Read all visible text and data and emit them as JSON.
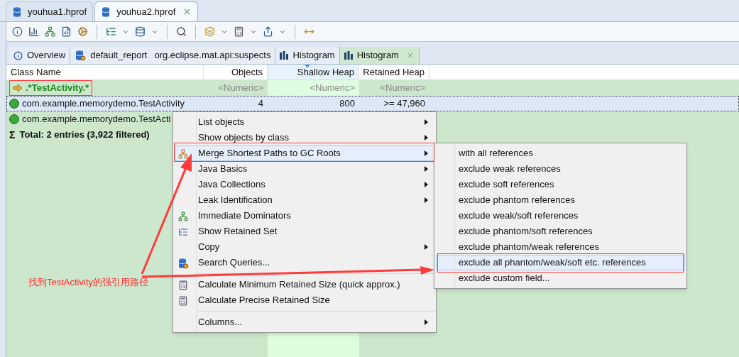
{
  "editor_tabs": [
    {
      "label": "youhua1.hprof",
      "selected": false,
      "closable": false
    },
    {
      "label": "youhua2.hprof",
      "selected": true,
      "closable": true
    }
  ],
  "result_tabs": [
    {
      "kind": "info",
      "label": "Overview",
      "selected": false
    },
    {
      "kind": "report",
      "label": "default_report",
      "detail": "org.eclipse.mat.api:suspects",
      "selected": false
    },
    {
      "kind": "histogram",
      "label": "Histogram",
      "selected": false,
      "closable": false
    },
    {
      "kind": "histogram",
      "label": "Histogram",
      "selected": true,
      "closable": true
    }
  ],
  "table": {
    "columns": [
      {
        "label": "Class Name",
        "sorted": false
      },
      {
        "label": "Objects",
        "sorted": false
      },
      {
        "label": "Shallow Heap",
        "sorted": true
      },
      {
        "label": "Retained Heap",
        "sorted": false
      }
    ],
    "filter_row": {
      "cells": [
        ".*TestActivity.*",
        "<Numeric>",
        "<Numeric>",
        "<Numeric>"
      ]
    },
    "rows": [
      {
        "cells": [
          "com.example.memorydemo.TestActivity",
          "4",
          "800",
          ">= 47,960"
        ],
        "selected": true
      },
      {
        "cells": [
          "com.example.memorydemo.TestActi"
        ],
        "selected": false
      }
    ],
    "total": {
      "symbol": "Σ",
      "label": "Total: 2 entries (3,922 filtered)"
    }
  },
  "context_menu": {
    "items": [
      {
        "kind": "item",
        "label": "List objects",
        "submenu": true,
        "selected": false
      },
      {
        "kind": "item",
        "label": "Show objects by class",
        "submenu": true,
        "selected": false
      },
      {
        "kind": "item",
        "label": "Merge Shortest Paths to GC Roots",
        "submenu": true,
        "selected": true
      },
      {
        "kind": "item",
        "label": "Java Basics",
        "submenu": true,
        "selected": false
      },
      {
        "kind": "item",
        "label": "Java Collections",
        "submenu": true,
        "selected": false
      },
      {
        "kind": "item",
        "label": "Leak Identification",
        "submenu": true,
        "selected": false
      },
      {
        "kind": "item",
        "label": "Immediate Dominators",
        "submenu": false,
        "selected": false
      },
      {
        "kind": "item",
        "label": "Show Retained Set",
        "submenu": false,
        "selected": false
      },
      {
        "kind": "item",
        "label": "Copy",
        "submenu": true,
        "selected": false
      },
      {
        "kind": "item",
        "label": "Search Queries...",
        "submenu": false,
        "selected": false
      },
      {
        "kind": "separator"
      },
      {
        "kind": "item",
        "label": "Calculate Minimum Retained Size (quick approx.)",
        "submenu": false,
        "selected": false
      },
      {
        "kind": "item",
        "label": "Calculate Precise Retained Size",
        "submenu": false,
        "selected": false
      },
      {
        "kind": "separator"
      },
      {
        "kind": "item",
        "label": "Columns...",
        "submenu": true,
        "selected": false
      }
    ]
  },
  "submenu": {
    "items": [
      {
        "label": "with all references",
        "selected": false
      },
      {
        "label": "exclude weak references",
        "selected": false
      },
      {
        "label": "exclude soft references",
        "selected": false
      },
      {
        "label": "exclude phantom references",
        "selected": false
      },
      {
        "label": "exclude weak/soft references",
        "selected": false
      },
      {
        "label": "exclude phantom/soft references",
        "selected": false
      },
      {
        "label": "exclude phantom/weak references",
        "selected": false
      },
      {
        "label": "exclude all phantom/weak/soft etc. references",
        "selected": true
      },
      {
        "label": "exclude custom field...",
        "selected": false
      }
    ]
  },
  "annotation": {
    "text": "找到TestActivity的强引用路径"
  }
}
